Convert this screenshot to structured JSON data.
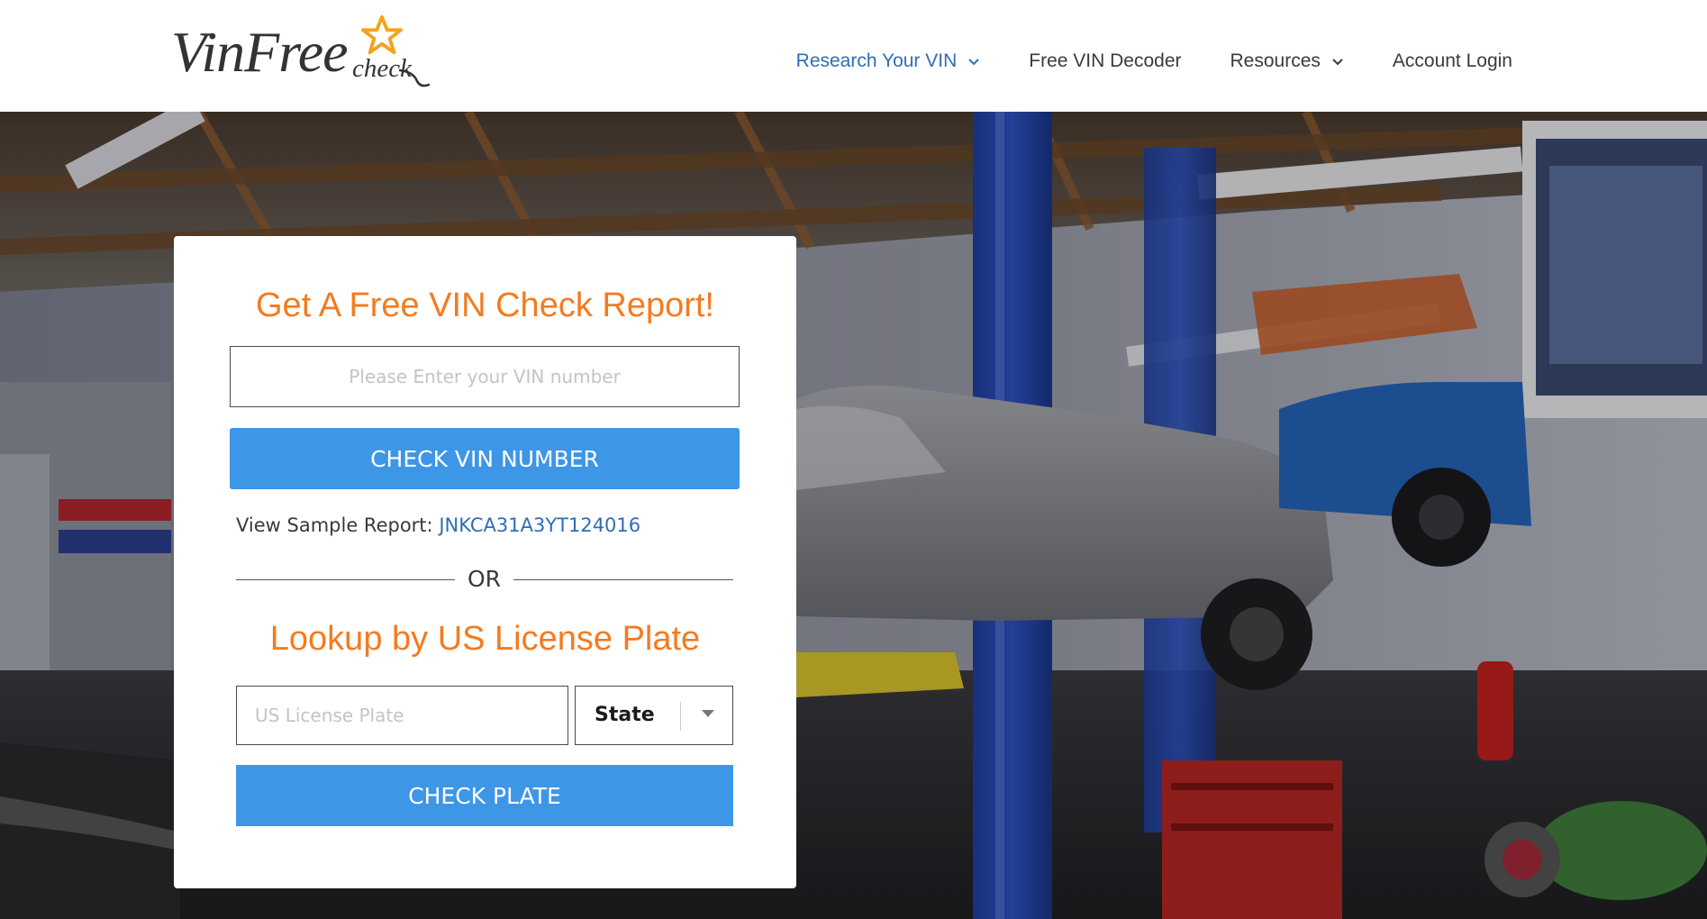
{
  "header": {
    "logo": {
      "main": "VinFree",
      "sub": "check"
    },
    "nav": [
      {
        "label": "Research Your VIN",
        "has_dropdown": true,
        "active": true
      },
      {
        "label": "Free VIN Decoder",
        "has_dropdown": false,
        "active": false
      },
      {
        "label": "Resources",
        "has_dropdown": true,
        "active": false
      },
      {
        "label": "Account Login",
        "has_dropdown": false,
        "active": false
      }
    ]
  },
  "hero": {
    "background": "garage-workshop-photo"
  },
  "card": {
    "title": "Get A Free VIN Check Report!",
    "vin_placeholder": "Please Enter your VIN number",
    "vin_value": "",
    "check_vin_label": "CHECK VIN NUMBER",
    "sample_label": "View Sample Report:",
    "sample_vin": "JNKCA31A3YT124016",
    "or_text": "OR",
    "plate_title": "Lookup by US License Plate",
    "plate_placeholder": "US License Plate",
    "plate_value": "",
    "state_label": "State",
    "check_plate_label": "CHECK PLATE"
  },
  "colors": {
    "accent_orange": "#f47b20",
    "button_blue": "#3d96e6",
    "link_blue": "#2f6db5",
    "text_dark": "#3a3a3a"
  },
  "icons": {
    "dropdown": "chevron-down-icon",
    "logo_star": "star-icon",
    "select_caret": "caret-down-icon"
  }
}
